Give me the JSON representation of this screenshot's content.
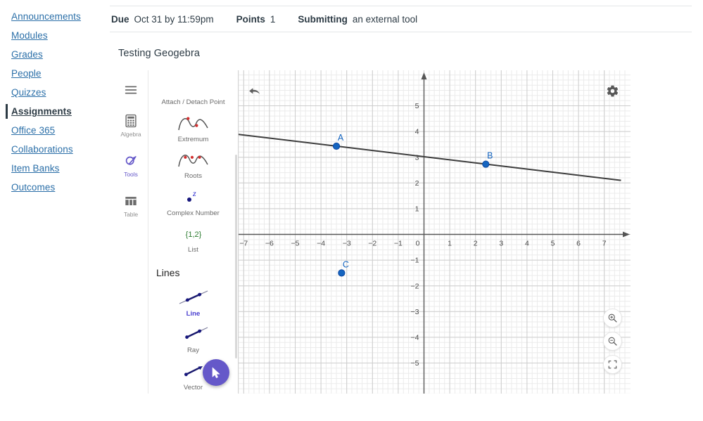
{
  "course_nav": {
    "items": [
      {
        "label": "Announcements",
        "active": false
      },
      {
        "label": "Modules",
        "active": false
      },
      {
        "label": "Grades",
        "active": false
      },
      {
        "label": "People",
        "active": false
      },
      {
        "label": "Quizzes",
        "active": false
      },
      {
        "label": "Assignments",
        "active": true
      },
      {
        "label": "Office 365",
        "active": false
      },
      {
        "label": "Collaborations",
        "active": false
      },
      {
        "label": "Item Banks",
        "active": false
      },
      {
        "label": "Outcomes",
        "active": false
      }
    ]
  },
  "assignment": {
    "meta": [
      {
        "key": "Due",
        "value": "Oct 31 by 11:59pm"
      },
      {
        "key": "Points",
        "value": "1"
      },
      {
        "key": "Submitting",
        "value": "an external tool"
      }
    ],
    "title": "Testing Geogebra"
  },
  "geogebra": {
    "rail": [
      {
        "name": "menu",
        "label": "",
        "icon": "hamburger-icon",
        "active": false
      },
      {
        "name": "algebra",
        "label": "Algebra",
        "icon": "calculator-icon",
        "active": false
      },
      {
        "name": "tools",
        "label": "Tools",
        "icon": "tools-icon",
        "active": true
      },
      {
        "name": "table",
        "label": "Table",
        "icon": "table-icon",
        "active": false
      }
    ],
    "tools_top": [
      {
        "label": "Attach / Detach Point",
        "icon": "attach-detach-point-icon",
        "selected": false
      },
      {
        "label": "Extremum",
        "icon": "extremum-icon",
        "selected": false
      },
      {
        "label": "Roots",
        "icon": "roots-icon",
        "selected": false
      },
      {
        "label": "Complex Number",
        "icon": "complex-number-icon",
        "selected": false
      },
      {
        "label": "List",
        "icon": "list-icon",
        "selected": false
      }
    ],
    "section_title": "Lines",
    "tools_lines": [
      {
        "label": "Line",
        "icon": "line-icon",
        "selected": true
      },
      {
        "label": "Ray",
        "icon": "ray-icon",
        "selected": false
      },
      {
        "label": "Vector",
        "icon": "vector-icon",
        "selected": false
      },
      {
        "label": "",
        "icon": "segment-icon",
        "selected": false
      }
    ],
    "list_icon_text": "{1,2}",
    "complex_icon_text": "z",
    "controls": {
      "undo": "undo-icon",
      "settings": "gear-icon",
      "zoom_in": "zoom-in-icon",
      "zoom_out": "zoom-out-icon",
      "fullscreen": "fullscreen-icon",
      "move_tool": "cursor-arrow-icon"
    }
  },
  "chart_data": {
    "type": "line",
    "title": "",
    "xlabel": "",
    "ylabel": "",
    "xlim": [
      -7.6,
      7.7
    ],
    "ylim": [
      -5.9,
      5.6
    ],
    "grid": true,
    "minor_grid": true,
    "x_ticks": [
      -7,
      -6,
      -5,
      -4,
      -3,
      -2,
      -1,
      0,
      1,
      2,
      3,
      4,
      5,
      6,
      7
    ],
    "y_ticks": [
      5,
      4,
      3,
      2,
      1,
      0,
      -1,
      -2,
      -3,
      -4,
      -5
    ],
    "x_tick_labels": [
      "−7",
      "−6",
      "−5",
      "−4",
      "−3",
      "−2",
      "−1",
      "0",
      "1",
      "2",
      "3",
      "4",
      "5",
      "6",
      "7"
    ],
    "y_tick_labels": [
      "5",
      "4",
      "3",
      "2",
      "1",
      "0",
      "−1",
      "−2",
      "−3",
      "−4",
      "−5"
    ],
    "series": [
      {
        "name": "line_AB",
        "type": "line",
        "color": "#3c3c3c",
        "x": [
          -7.55,
          7.65
        ],
        "y": [
          3.93,
          2.1
        ]
      }
    ],
    "points": [
      {
        "label": "A",
        "x": -3.4,
        "y": 3.43,
        "color": "#1565c0"
      },
      {
        "label": "B",
        "x": 2.4,
        "y": 2.73,
        "color": "#1565c0"
      },
      {
        "label": "C",
        "x": -3.2,
        "y": -1.5,
        "color": "#1565c0"
      }
    ]
  }
}
